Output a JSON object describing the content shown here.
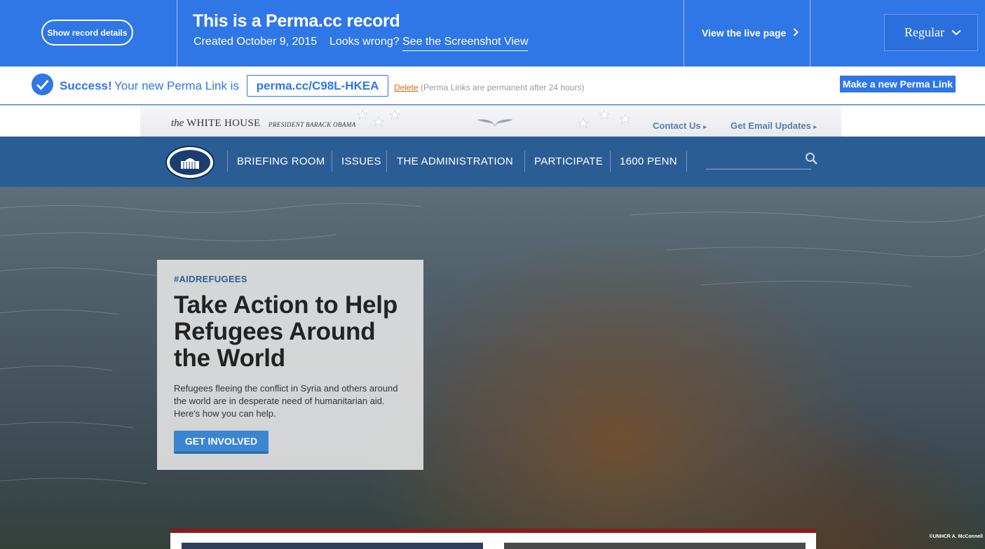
{
  "perma_bar": {
    "show_details_label": "Show record details",
    "title": "This is a Perma.cc record",
    "created": "Created October 9, 2015",
    "looks_wrong": "Looks wrong?",
    "screenshot_link": "See the Screenshot View",
    "live_page": "View the live page",
    "mode_select": "Regular"
  },
  "success_bar": {
    "strong": "Success!",
    "text": "Your new Perma Link is",
    "perma_link": "perma.cc/C98L-HKEA",
    "delete": "Delete",
    "delete_note": "(Perma Links are permanent after 24 hours)",
    "new_link_button": "Make a new Perma Link"
  },
  "wh_header": {
    "brand_prefix": "the",
    "brand": "WHITE HOUSE",
    "president": "PRESIDENT BARACK OBAMA",
    "contact": "Contact Us",
    "email_updates": "Get Email Updates"
  },
  "nav": {
    "items": [
      "BRIEFING ROOM",
      "ISSUES",
      "THE ADMINISTRATION",
      "PARTICIPATE",
      "1600 PENN"
    ]
  },
  "hero": {
    "hashtag": "#AIDREFUGEES",
    "title": "Take Action to Help Refugees Around the World",
    "body": "Refugees fleeing the conflict in Syria and others around the world are in desperate need of humanitarian aid. Here's how you can help.",
    "cta": "GET INVOLVED",
    "credit": "©UNHCR A. McConnell"
  },
  "colors": {
    "perma_blue": "#2f76e6",
    "nav_blue": "#2b5d95",
    "accent_red": "#8b1a1a",
    "delete_orange": "#d66a1c"
  },
  "icons": [
    "chevron-right-icon",
    "chevron-down-icon",
    "checkmark-icon",
    "eagle-icon",
    "star-icon",
    "seal-icon",
    "search-icon"
  ]
}
